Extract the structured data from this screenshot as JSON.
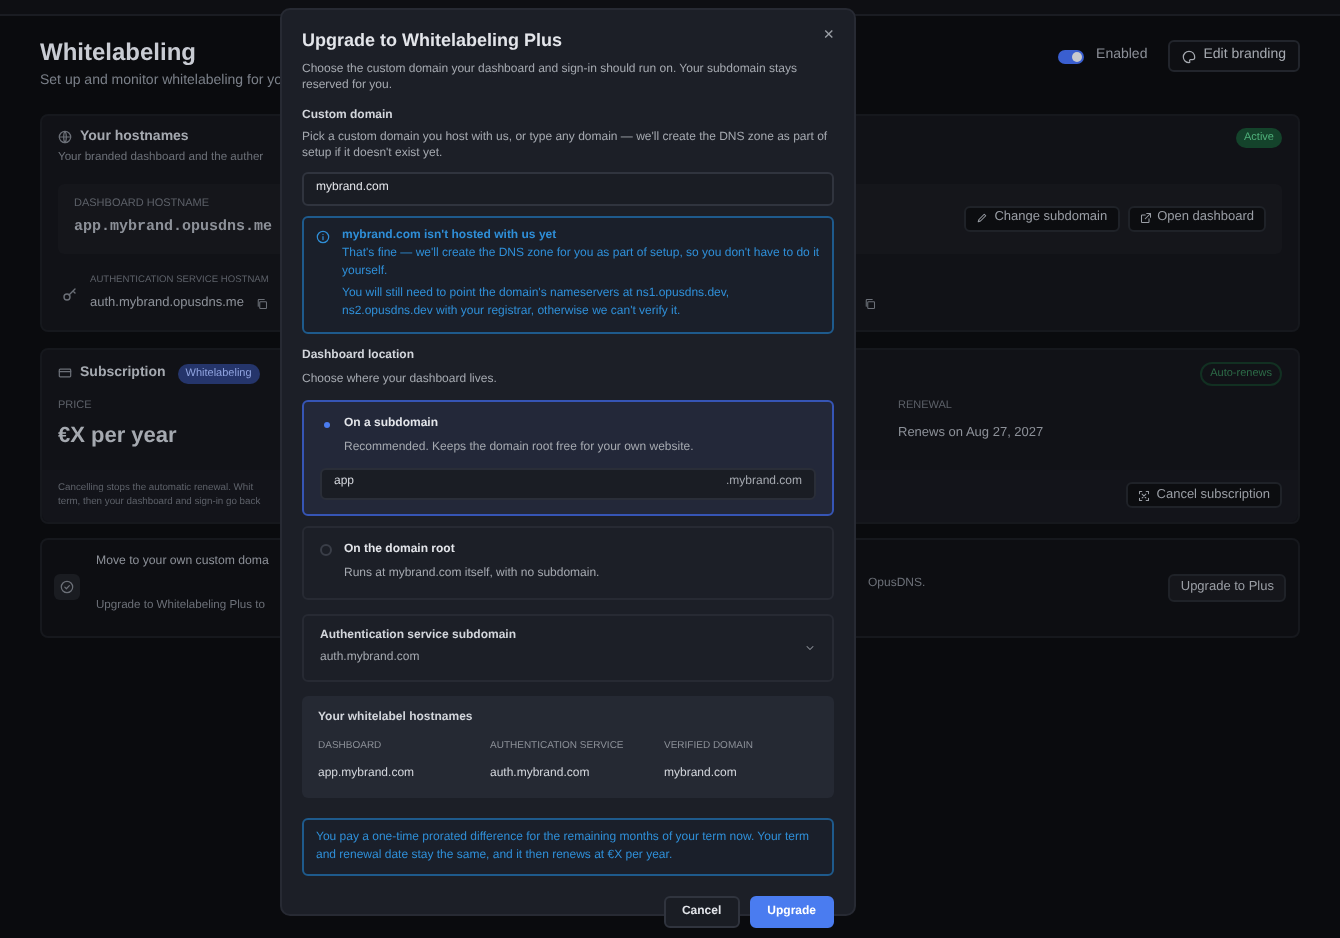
{
  "page": {
    "title": "Whitelabeling",
    "subtitle": "Set up and monitor whitelabeling for yo",
    "enabled_toggle": {
      "label": "Enabled",
      "on": true
    },
    "edit_branding": "Edit branding",
    "hostnames_card": {
      "title": "Your hostnames",
      "description": "Your branded dashboard and the auther",
      "status": "Active",
      "dashboard_label": "DASHBOARD HOSTNAME",
      "dashboard_value": "app.mybrand.opusdns.me",
      "change_subdomain": "Change subdomain",
      "open_dashboard": "Open dashboard",
      "auth_label": "AUTHENTICATION SERVICE HOSTNAM",
      "auth_value": "auth.mybrand.opusdns.me"
    },
    "subscription_card": {
      "title": "Subscription",
      "badge": "Whitelabeling",
      "status": "Auto-renews",
      "price_label": "PRICE",
      "price": "€X per year",
      "renewal_label": "RENEWAL",
      "renewal": "Renews on Aug 27, 2027",
      "note_line_1": "Cancelling stops the automatic renewal. Whit",
      "note_line_2": "term, then your dashboard and sign-in go back",
      "cancel_subscription": "Cancel subscription"
    },
    "upgrade_card": {
      "title": "Move to your own custom doma",
      "description": "Upgrade to Whitelabeling Plus to",
      "description_end": "OpusDNS.",
      "button": "Upgrade to Plus"
    }
  },
  "modal": {
    "title": "Upgrade to Whitelabeling Plus",
    "close": "×",
    "description": "Choose the custom domain your dashboard and sign-in should run on. Your subdomain stays reserved for you.",
    "custom_domain": {
      "label": "Custom domain",
      "help": "Pick a custom domain you host with us, or type any domain — we'll create the DNS zone as part of setup if it doesn't exist yet.",
      "value": "mybrand.com"
    },
    "info": {
      "title": "mybrand.com isn't hosted with us yet",
      "line_1": "That's fine — we'll create the DNS zone for you as part of setup, so you don't have to do it yourself.",
      "line_2": "You will still need to point the domain's nameservers at ns1.opusdns.dev, ns2.opusdns.dev with your registrar, otherwise we can't verify it."
    },
    "location": {
      "label": "Dashboard location",
      "help": "Choose where your dashboard lives."
    },
    "location_options": [
      {
        "kind": "subdomain",
        "title": "On a subdomain",
        "description": "Recommended. Keeps the domain root free for your own website.",
        "selected": true,
        "value": "app",
        "suffix": ".mybrand.com"
      },
      {
        "kind": "root",
        "title": "On the domain root",
        "description": "Runs at mybrand.com itself, with no subdomain.",
        "selected": false
      }
    ],
    "auth_subdomain": {
      "label": "Authentication service subdomain",
      "value": "auth.mybrand.com",
      "expanded": false
    },
    "hostnames": {
      "title": "Your whitelabel hostnames",
      "columns": [
        {
          "label": "DASHBOARD",
          "value": "app.mybrand.com"
        },
        {
          "label": "AUTHENTICATION SERVICE",
          "value": "auth.mybrand.com"
        },
        {
          "label": "VERIFIED DOMAIN",
          "value": "mybrand.com"
        }
      ]
    },
    "note": "You pay a one-time prorated difference for the remaining months of your term now. Your term and renewal date stay the same, and it then renews at €X per year.",
    "buttons": [
      {
        "kind": "secondary",
        "label": "Cancel"
      },
      {
        "kind": "primary",
        "label": "Upgrade"
      }
    ]
  }
}
